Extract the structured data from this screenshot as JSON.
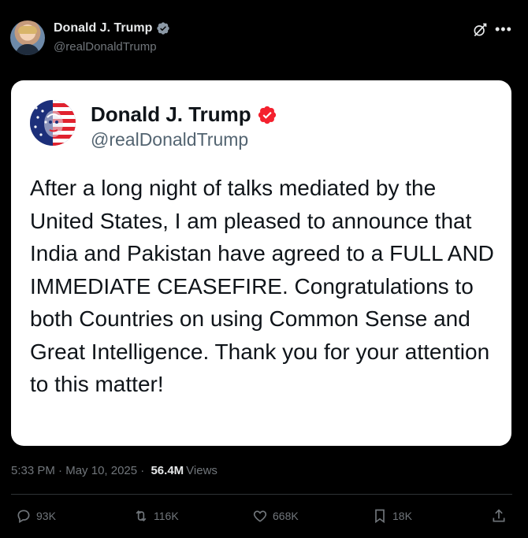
{
  "author": {
    "display_name": "Donald J. Trump",
    "handle": "@realDonaldTrump",
    "verified": "verified-badge-icon"
  },
  "embedded_post": {
    "display_name": "Donald J. Trump",
    "handle": "@realDonaldTrump",
    "text": "After a long night of talks mediated by the United States, I am pleased to announce that India and Pakistan have agreed to a FULL AND IMMEDIATE CEASEFIRE. Congratulations to both Countries on using Common Sense and Great Intelligence. Thank you for your attention to this matter!"
  },
  "meta": {
    "time": "5:33 PM",
    "sep1": " · ",
    "date": "May 10, 2025",
    "sep2": " · ",
    "views_count": "56.4M",
    "views_label": "Views"
  },
  "actions": {
    "replies": "93K",
    "reposts": "116K",
    "likes": "668K",
    "bookmarks": "18K"
  },
  "colors": {
    "background": "#000000",
    "verified_blue": "#1d9bf0",
    "verified_red": "#f4212e",
    "muted": "#71767b"
  }
}
